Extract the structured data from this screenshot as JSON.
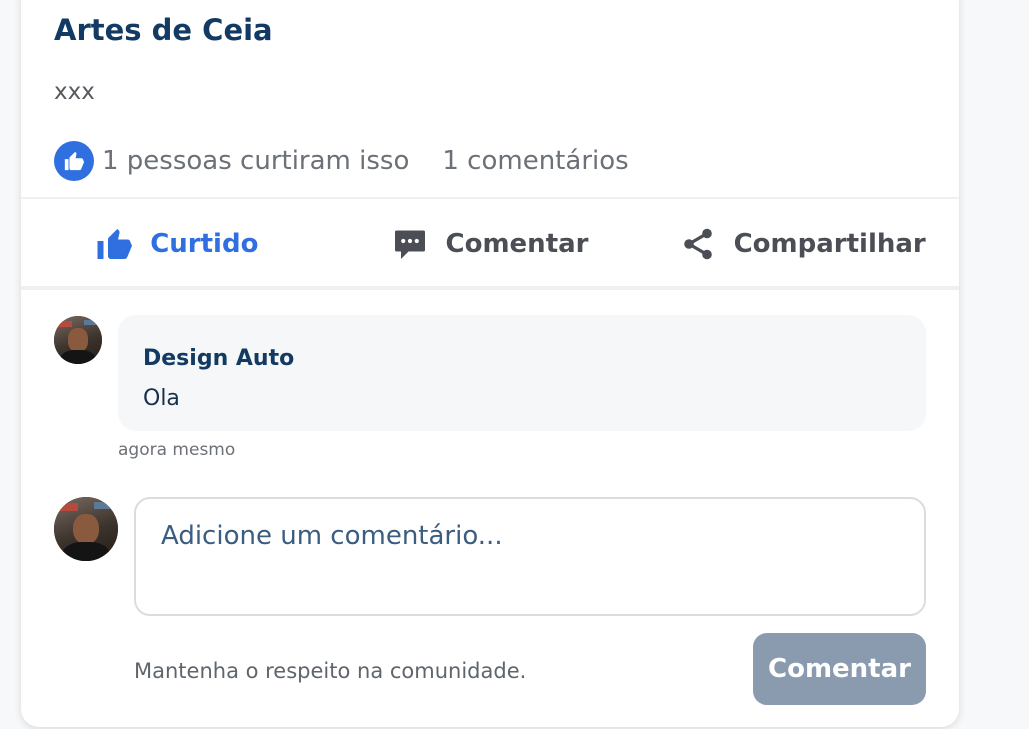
{
  "post": {
    "title": "Artes de Ceia",
    "body": "xxx",
    "likes_text": "1 pessoas curtiram isso",
    "comments_text": "1 comentários"
  },
  "actions": {
    "like_label": "Curtido",
    "comment_label": "Comentar",
    "share_label": "Compartilhar"
  },
  "comments": [
    {
      "author": "Design Auto",
      "text": "Ola",
      "time": "agora mesmo"
    }
  ],
  "composer": {
    "placeholder": "Adicione um comentário...",
    "note": "Mantenha o respeito na comunidade.",
    "submit_label": "Comentar"
  },
  "colors": {
    "accent": "#2f6fe0",
    "title": "#123a63",
    "submit_disabled": "#8a9bb0"
  }
}
